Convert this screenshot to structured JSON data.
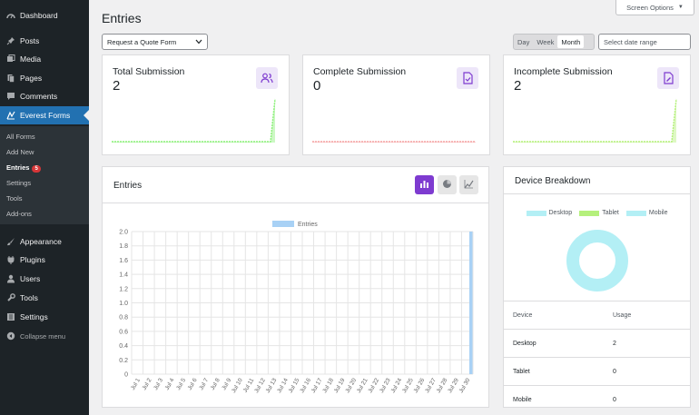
{
  "sidebar": {
    "menu": [
      {
        "label": "Dashboard",
        "icon": "dashboard-icon"
      },
      {
        "label": "Posts",
        "icon": "pin-icon"
      },
      {
        "label": "Media",
        "icon": "media-icon"
      },
      {
        "label": "Pages",
        "icon": "page-icon"
      },
      {
        "label": "Comments",
        "icon": "comment-icon"
      },
      {
        "label": "Everest Forms",
        "icon": "form-icon"
      },
      {
        "label": "Appearance",
        "icon": "brush-icon"
      },
      {
        "label": "Plugins",
        "icon": "plug-icon"
      },
      {
        "label": "Users",
        "icon": "user-icon"
      },
      {
        "label": "Tools",
        "icon": "wrench-icon"
      },
      {
        "label": "Settings",
        "icon": "settings-icon"
      },
      {
        "label": "Collapse menu",
        "icon": "collapse-icon"
      }
    ],
    "submenu": [
      {
        "label": "All Forms"
      },
      {
        "label": "Add New"
      },
      {
        "label": "Entries",
        "badge": "5"
      },
      {
        "label": "Settings"
      },
      {
        "label": "Tools"
      },
      {
        "label": "Add-ons"
      }
    ]
  },
  "header": {
    "title": "Entries",
    "screen_options": "Screen Options",
    "form_select": "Request a Quote Form",
    "ranges": [
      "Day",
      "Week",
      "Month"
    ],
    "selected_range": "Month",
    "date_placeholder": "Select date range"
  },
  "stats": [
    {
      "label": "Total Submission",
      "value": "2",
      "color": "#8ef07c",
      "icon": "users-icon"
    },
    {
      "label": "Complete Submission",
      "value": "0",
      "color": "#f5a3a3",
      "icon": "file-check-icon"
    },
    {
      "label": "Incomplete Submission",
      "value": "2",
      "color": "#b5f07c",
      "icon": "file-edit-icon"
    }
  ],
  "entries_panel": {
    "title": "Entries",
    "accent": "#7e3bd0"
  },
  "device_panel": {
    "title": "Device Breakdown",
    "legend": [
      {
        "label": "Desktop",
        "color": "#b3eff5"
      },
      {
        "label": "Tablet",
        "color": "#b5f07c"
      },
      {
        "label": "Mobile",
        "color": "#b3eff5"
      }
    ],
    "table": {
      "headers": [
        "Device",
        "Usage"
      ],
      "rows": [
        [
          "Desktop",
          "2"
        ],
        [
          "Tablet",
          "0"
        ],
        [
          "Mobile",
          "0"
        ]
      ]
    }
  },
  "chart_data": {
    "type": "bar",
    "series": [
      {
        "name": "Entries",
        "values": [
          0,
          0,
          0,
          0,
          0,
          0,
          0,
          0,
          0,
          0,
          0,
          0,
          0,
          0,
          0,
          0,
          0,
          0,
          0,
          0,
          0,
          0,
          0,
          0,
          0,
          0,
          0,
          0,
          0,
          2
        ]
      }
    ],
    "categories": [
      "Jul 1",
      "Jul 2",
      "Jul 3",
      "Jul 4",
      "Jul 5",
      "Jul 6",
      "Jul 7",
      "Jul 8",
      "Jul 9",
      "Jul 10",
      "Jul 11",
      "Jul 12",
      "Jul 13",
      "Jul 14",
      "Jul 15",
      "Jul 16",
      "Jul 17",
      "Jul 18",
      "Jul 19",
      "Jul 20",
      "Jul 21",
      "Jul 22",
      "Jul 23",
      "Jul 24",
      "Jul 25",
      "Jul 26",
      "Jul 27",
      "Jul 28",
      "Jul 29",
      "Jul 30"
    ],
    "yticks": [
      "0",
      "0.2",
      "0.4",
      "0.6",
      "0.8",
      "1.0",
      "1.2",
      "1.4",
      "1.6",
      "1.8",
      "2.0"
    ],
    "ylim": [
      0,
      2
    ],
    "legend": "top-center",
    "grid": true,
    "color": "#a8d1f5"
  }
}
